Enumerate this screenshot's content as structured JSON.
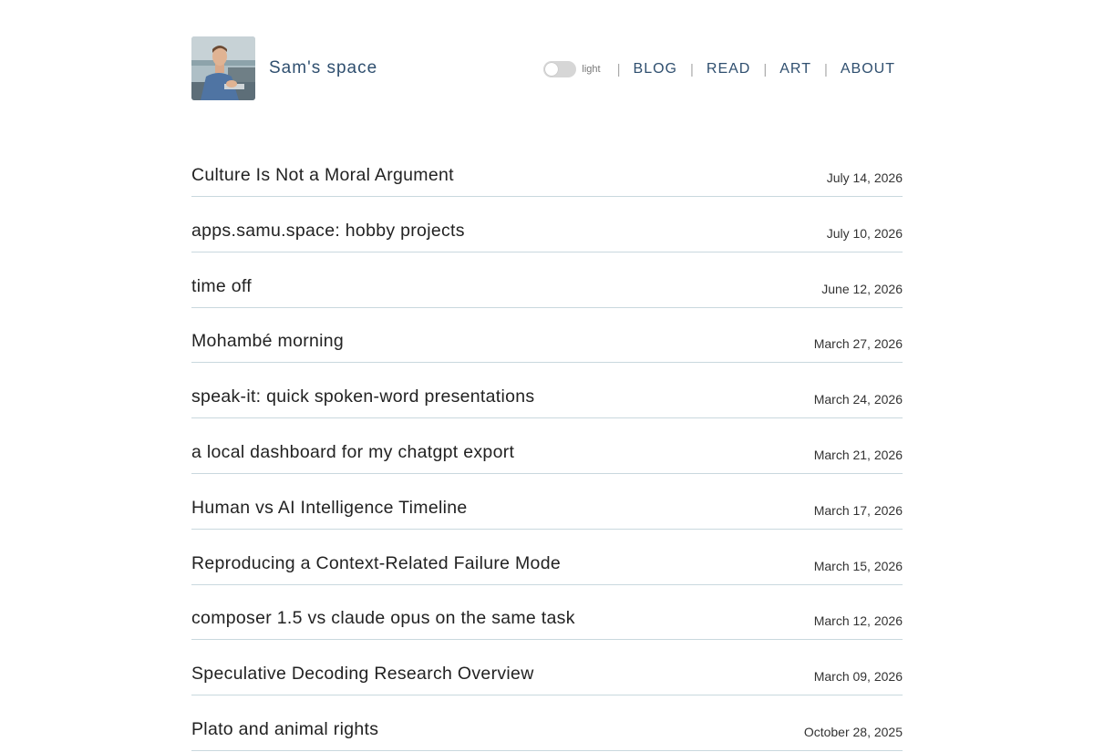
{
  "site": {
    "title": "Sam's space"
  },
  "theme_toggle": {
    "label": "light"
  },
  "nav": {
    "items": [
      {
        "label": "BLOG"
      },
      {
        "label": "READ"
      },
      {
        "label": "ART"
      },
      {
        "label": "ABOUT"
      }
    ]
  },
  "posts": [
    {
      "title": "Culture Is Not a Moral Argument",
      "date": "July 14, 2026"
    },
    {
      "title": "apps.samu.space: hobby projects",
      "date": "July 10, 2026"
    },
    {
      "title": "time off",
      "date": "June 12, 2026"
    },
    {
      "title": "Mohambé morning",
      "date": "March 27, 2026"
    },
    {
      "title": "speak-it: quick spoken-word presentations",
      "date": "March 24, 2026"
    },
    {
      "title": "a local dashboard for my chatgpt export",
      "date": "March 21, 2026"
    },
    {
      "title": "Human vs AI Intelligence Timeline",
      "date": "March 17, 2026"
    },
    {
      "title": "Reproducing a Context-Related Failure Mode",
      "date": "March 15, 2026"
    },
    {
      "title": "composer 1.5 vs claude opus on the same task",
      "date": "March 12, 2026"
    },
    {
      "title": "Speculative Decoding Research Overview",
      "date": "March 09, 2026"
    },
    {
      "title": "Plato and animal rights",
      "date": "October 28, 2025"
    }
  ],
  "colors": {
    "accent": "#2f4f6f",
    "divider": "#c9d8de"
  }
}
